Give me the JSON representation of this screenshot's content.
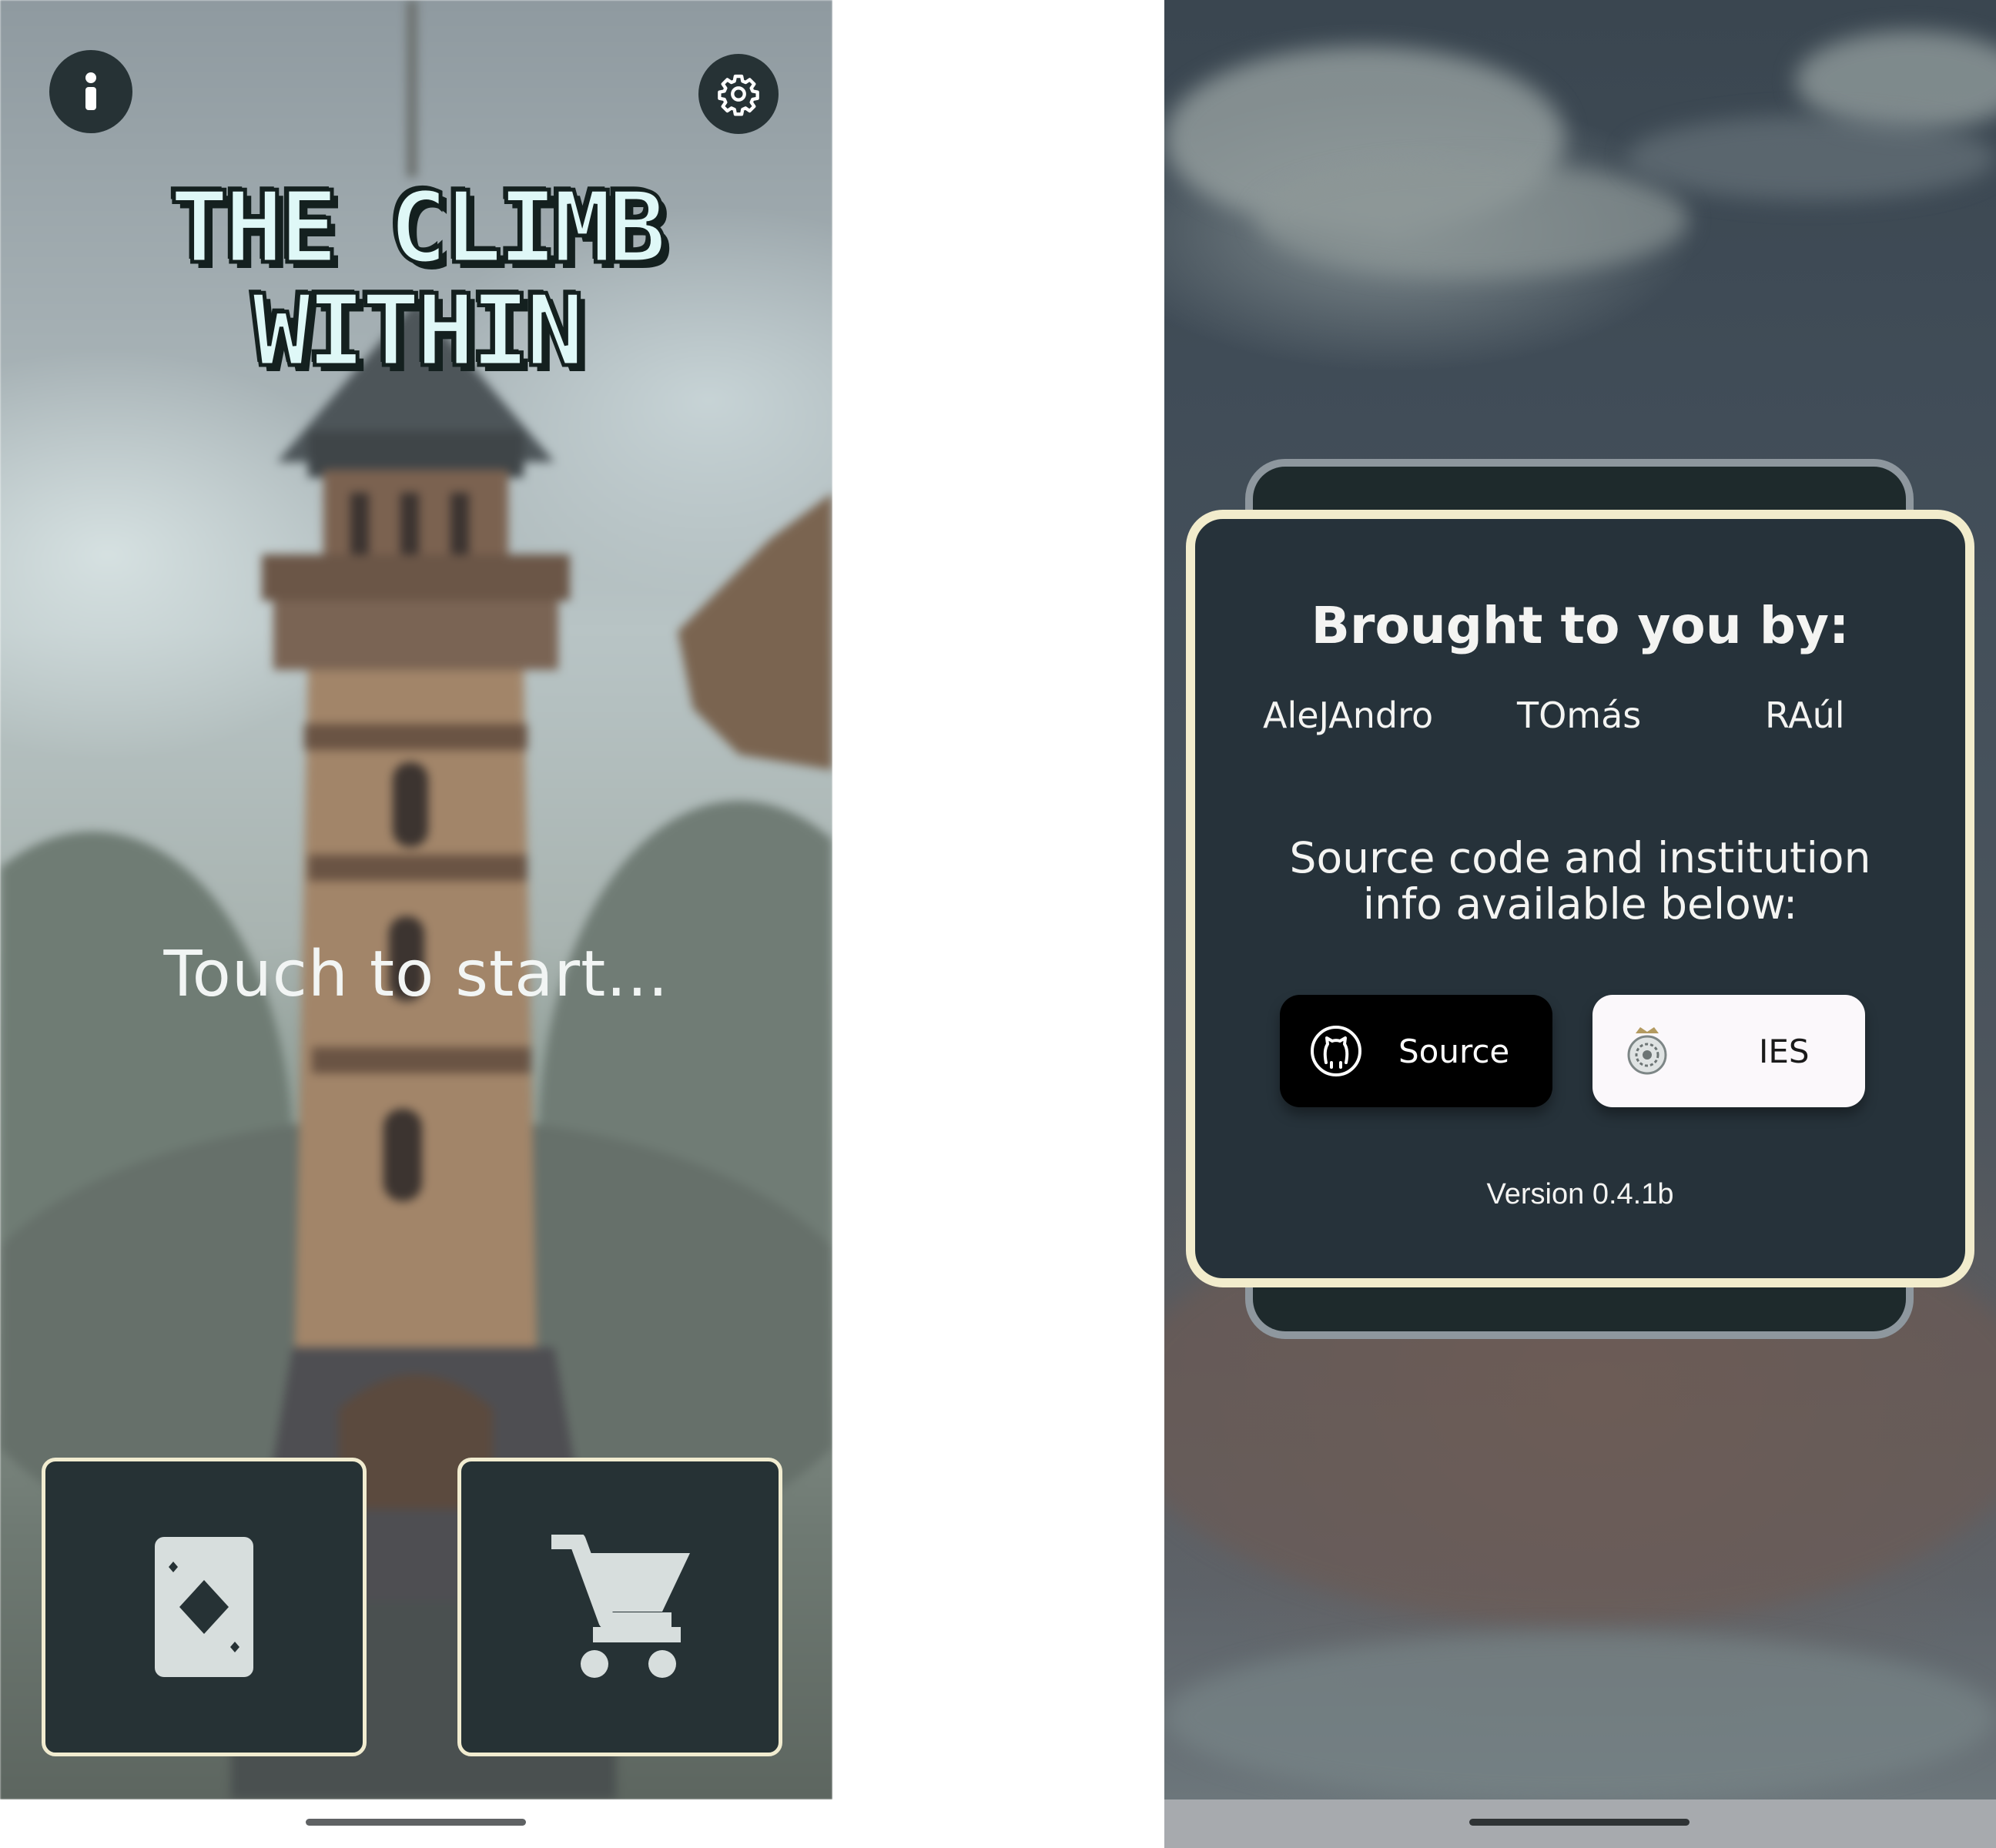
{
  "main_menu": {
    "title": "THE CLIMB WITHIN",
    "prompt": "Touch to start...",
    "info_icon": "info-icon",
    "settings_icon": "gear-icon",
    "cards_icon": "playing-card-diamond-icon",
    "shop_icon": "shopping-cart-icon"
  },
  "credits_dialog": {
    "heading": "Brought to you by:",
    "authors": [
      "AleJAndro",
      "TOmás",
      "RAúl"
    ],
    "info_text": "Source code and institution info available below:",
    "source_button": {
      "label": "Source",
      "icon": "github-icon"
    },
    "institution_button": {
      "label": "IES",
      "icon": "institution-seal-icon"
    },
    "version": "Version 0.4.1b"
  },
  "colors": {
    "panel": "#263235",
    "panel_border": "#f1ecd0",
    "text_light": "#f4f4f2",
    "title_fill": "#dff8f7"
  }
}
